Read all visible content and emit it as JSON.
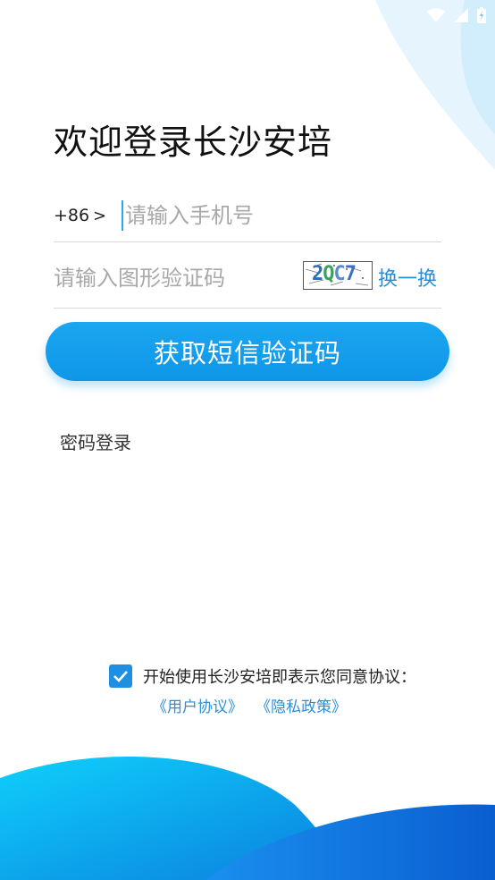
{
  "status_bar": {
    "icons": [
      "wifi-icon",
      "signal-icon",
      "battery-icon"
    ]
  },
  "header": {
    "title": "欢迎登录长沙安培"
  },
  "phone": {
    "country_code": "+86",
    "chevron": ">",
    "placeholder": "请输入手机号",
    "value": ""
  },
  "captcha": {
    "placeholder": "请输入图形验证码",
    "value": "",
    "image_text": "2QC7",
    "refresh_label": "换一换"
  },
  "actions": {
    "sms_button_label": "获取短信验证码",
    "password_login_label": "密码登录"
  },
  "agreement": {
    "checked": true,
    "text": "开始使用长沙安培即表示您同意协议：",
    "user_agreement_link": "《用户协议》",
    "privacy_policy_link": "《隐私政策》"
  },
  "colors": {
    "primary": "#1e8fe1",
    "button": "#139ceb",
    "deco_light": "#e4f4fd",
    "deco_dark": "#0d6fd6"
  }
}
